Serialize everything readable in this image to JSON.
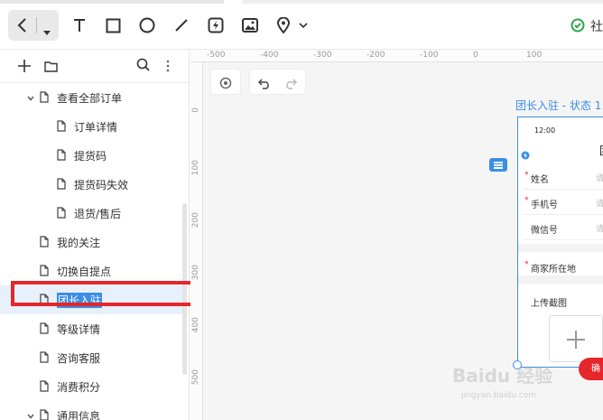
{
  "toolbar": {
    "tools": [
      {
        "icon": "back-arrow-icon"
      },
      {
        "icon": "chevron-down-icon"
      },
      {
        "icon": "text-tool-icon"
      },
      {
        "icon": "rectangle-tool-icon"
      },
      {
        "icon": "ellipse-tool-icon"
      },
      {
        "icon": "line-tool-icon"
      },
      {
        "icon": "interaction-tool-icon"
      },
      {
        "icon": "image-tool-icon"
      },
      {
        "icon": "location-pin-icon"
      }
    ],
    "status_text": "社"
  },
  "sidebar": {
    "items": [
      {
        "label": "查看全部订单",
        "level": 1,
        "expanded": true
      },
      {
        "label": "订单详情",
        "level": 2
      },
      {
        "label": "提货码",
        "level": 2
      },
      {
        "label": "提货码失效",
        "level": 2
      },
      {
        "label": "退货/售后",
        "level": 2
      },
      {
        "label": "我的关注",
        "level": 1
      },
      {
        "label": "切换自提点",
        "level": 1
      },
      {
        "label": "团长入驻",
        "level": 1,
        "selected": true
      },
      {
        "label": "等级详情",
        "level": 1
      },
      {
        "label": "咨询客服",
        "level": 1
      },
      {
        "label": "消费积分",
        "level": 1
      },
      {
        "label": "通用信息",
        "level": 1,
        "expanded": true
      }
    ]
  },
  "canvas": {
    "ruler_x": [
      "-500",
      "-400",
      "-300",
      "-200",
      "-100",
      "0",
      "100"
    ],
    "ruler_y": [
      "0",
      "100",
      "200",
      "300",
      "400",
      "500"
    ],
    "artboard": {
      "title": "团长入驻 - 状态 1",
      "time": "12:00",
      "header_char": "团",
      "fields": [
        {
          "label": "姓名",
          "required": true,
          "placeholder": "请"
        },
        {
          "label": "手机号",
          "required": true,
          "placeholder": "请"
        },
        {
          "label": "微信号",
          "required": false,
          "placeholder": "请"
        },
        {
          "label": "商家所在地",
          "required": true,
          "placeholder": ""
        }
      ],
      "upload_label": "上传截图",
      "submit_label": "确"
    },
    "watermark": "Baidu 经验",
    "watermark_sub": "jingyan.baidu.com"
  },
  "colors": {
    "accent": "#3a8ee6",
    "highlight": "#e5262b"
  }
}
